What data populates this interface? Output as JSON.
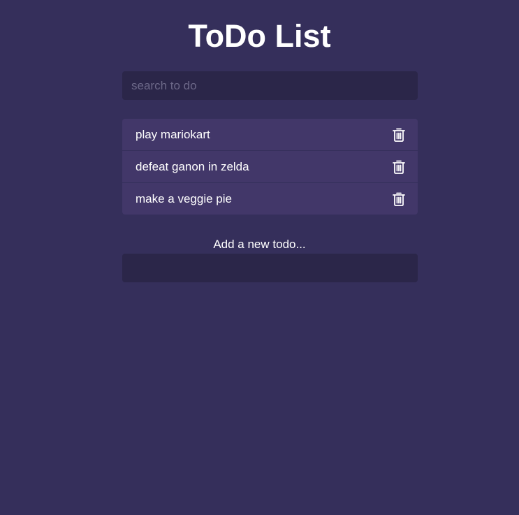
{
  "header": {
    "title": "ToDo List"
  },
  "search": {
    "value": "",
    "placeholder": "search to do"
  },
  "todos": [
    {
      "text": "play mariokart",
      "icon": "trash-icon"
    },
    {
      "text": "defeat ganon in zelda",
      "icon": "trash-icon"
    },
    {
      "text": "make a veggie pie",
      "icon": "trash-icon"
    }
  ],
  "add_form": {
    "label": "Add a new todo...",
    "value": ""
  },
  "colors": {
    "background": "#352f5b",
    "input_background": "#2b2649",
    "item_background": "#423769",
    "text": "#ffffff",
    "placeholder": "#6c6888"
  }
}
